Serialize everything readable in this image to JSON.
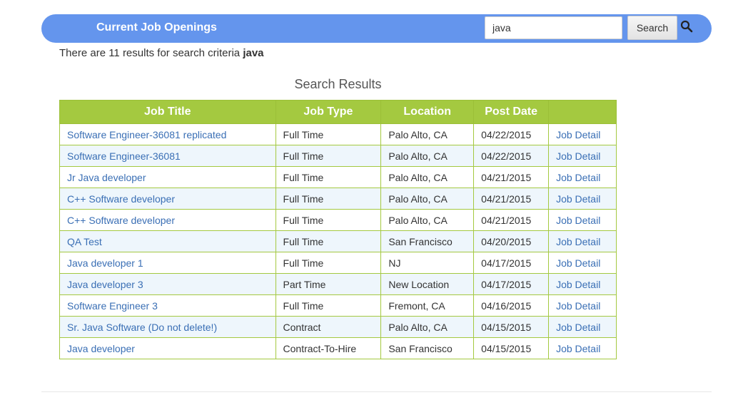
{
  "header": {
    "title": "Current Job Openings",
    "search_value": "java",
    "search_button_label": "Search",
    "search_icon": "search-icon"
  },
  "summary": {
    "prefix": "There are 11 results for search criteria ",
    "term": "java"
  },
  "results": {
    "title": "Search Results",
    "columns": [
      "Job Title",
      "Job Type",
      "Location",
      "Post Date",
      ""
    ],
    "rows": [
      {
        "title": "Software Engineer-36081 replicated",
        "type": "Full Time",
        "location": "Palo Alto, CA",
        "date": "04/22/2015",
        "link": "Job Detail"
      },
      {
        "title": "Software Engineer-36081",
        "type": "Full Time",
        "location": "Palo Alto, CA",
        "date": "04/22/2015",
        "link": "Job Detail"
      },
      {
        "title": "Jr Java developer",
        "type": "Full Time",
        "location": "Palo Alto, CA",
        "date": "04/21/2015",
        "link": "Job Detail"
      },
      {
        "title": "C++ Software developer",
        "type": "Full Time",
        "location": "Palo Alto, CA",
        "date": "04/21/2015",
        "link": "Job Detail"
      },
      {
        "title": "C++ Software developer",
        "type": "Full Time",
        "location": "Palo Alto, CA",
        "date": "04/21/2015",
        "link": "Job Detail"
      },
      {
        "title": "QA Test",
        "type": "Full Time",
        "location": "San Francisco",
        "date": "04/20/2015",
        "link": "Job Detail"
      },
      {
        "title": "Java developer 1",
        "type": "Full Time",
        "location": "NJ",
        "date": "04/17/2015",
        "link": "Job Detail"
      },
      {
        "title": "Java developer 3",
        "type": "Part Time",
        "location": "New Location",
        "date": "04/17/2015",
        "link": "Job Detail"
      },
      {
        "title": "Software Engineer 3",
        "type": "Full Time",
        "location": "Fremont, CA",
        "date": "04/16/2015",
        "link": "Job Detail"
      },
      {
        "title": "Sr. Java Software (Do not delete!)",
        "type": "Contract",
        "location": "Palo Alto, CA",
        "date": "04/15/2015",
        "link": "Job Detail"
      },
      {
        "title": "Java developer",
        "type": "Contract-To-Hire",
        "location": "San Francisco",
        "date": "04/15/2015",
        "link": "Job Detail"
      }
    ]
  },
  "colors": {
    "header_bg": "#6495ed",
    "table_header_bg": "#a4c940",
    "link": "#3a6fb5",
    "row_alt_bg": "#eef6fc"
  }
}
